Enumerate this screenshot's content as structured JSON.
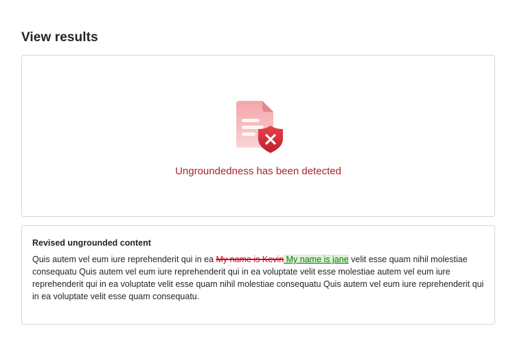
{
  "page": {
    "title": "View results"
  },
  "result": {
    "icon": "document-shield-error-icon",
    "message": "Ungroundedness has been detected",
    "accent_color": "#a4262c"
  },
  "revised": {
    "heading": "Revised ungrounded content",
    "text_before": "Quis autem vel eum iure reprehenderit qui in ea ",
    "removed": "My name is Kevin",
    "inserted": " My name is jane",
    "text_after": " velit esse quam nihil molestiae consequatu Quis autem vel eum iure reprehenderit qui in ea voluptate velit esse molestiae  autem vel eum iure reprehenderit qui in ea voluptate velit esse quam nihil molestiae consequatu Quis autem vel eum iure reprehenderit qui in ea voluptate velit esse quam consequatu.",
    "removed_color": "#c50f1f",
    "inserted_color": "#107c10",
    "inserted_highlight": "#dff0d8"
  }
}
